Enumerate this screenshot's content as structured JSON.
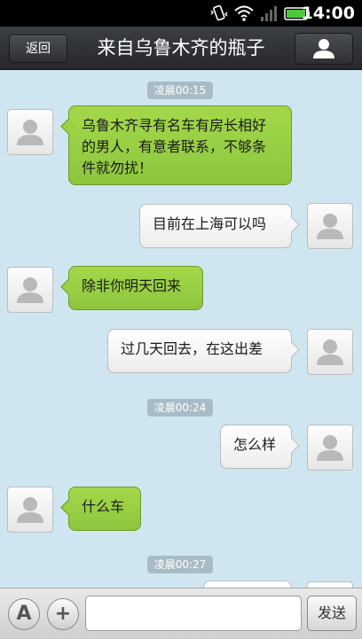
{
  "status_bar": {
    "time": "14:00",
    "icons": [
      "vibrate-icon",
      "wifi-icon",
      "signal-icon",
      "battery-icon"
    ]
  },
  "header": {
    "back_label": "返回",
    "title": "来自乌鲁木齐的瓶子",
    "profile_icon": "person-icon"
  },
  "messages": {
    "ts1": "凌晨00:15",
    "m1": "乌鲁木齐寻有名车有房长相好的男人，有意者联系，不够条件就勿扰！",
    "m2": "目前在上海可以吗",
    "m3": "除非你明天回来",
    "m4": "过几天回去，在这出差",
    "ts2": "凌晨00:24",
    "m5": "怎么样",
    "m6": "什么车",
    "ts3": "凌晨00:27"
  },
  "input_bar": {
    "text_mode_label": "A",
    "add_label": "+",
    "placeholder": "",
    "send_label": "发送"
  },
  "colors": {
    "incoming_bubble": "#9bd045",
    "outgoing_bubble": "#f4f4f4",
    "chat_background": "#cfe6f0",
    "header_background": "#2e3034"
  }
}
